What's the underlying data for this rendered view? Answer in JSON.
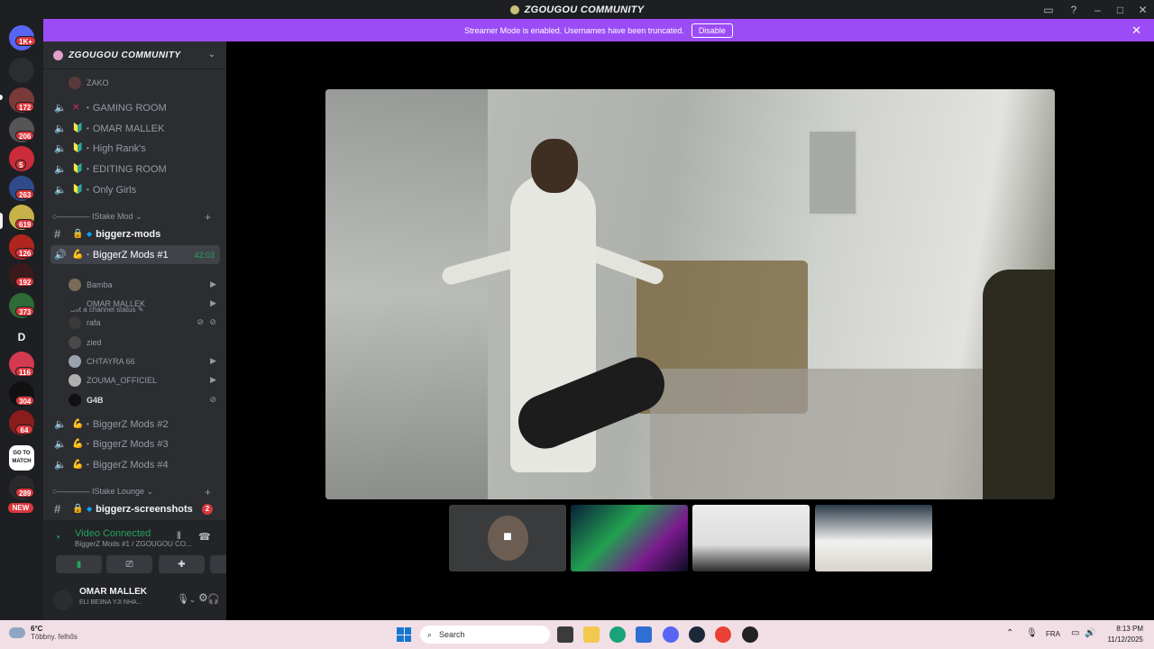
{
  "window": {
    "title": "ZGOUGOU COMMUNITY"
  },
  "banner": {
    "text": "Streamer Mode is enabled. Usernames have been truncated.",
    "button": "Disable"
  },
  "rail": {
    "home_badge": "1K+",
    "badges": [
      "172",
      "206",
      "5",
      "263",
      "619",
      "126",
      "192",
      "373",
      "116",
      "304",
      "64",
      "289"
    ],
    "letter_server": "D",
    "new_label": "NEW",
    "match_label": "GO TO MATCH"
  },
  "server": {
    "name": "ZGOUGOU COMMUNITY"
  },
  "channels": {
    "top_user": "ZAKO",
    "voice_top": [
      {
        "emoji": "✕",
        "label": "GAMING ROOM"
      },
      {
        "emoji": "🔰",
        "label": "OMAR MALLEK"
      },
      {
        "emoji": "🔰",
        "label": "High Rank's"
      },
      {
        "emoji": "🔰",
        "label": "EDITING ROOM"
      },
      {
        "emoji": "🔰",
        "label": "Only Girls"
      }
    ],
    "category_mod": "IStake Mod",
    "text_mods": "biggerz-mods",
    "active_voice": {
      "label": "BiggerZ Mods #1",
      "duration": "42:03",
      "status": "Set a channel status"
    },
    "members": [
      {
        "name": "Bamba"
      },
      {
        "name": "OMAR MALLEK"
      },
      {
        "name": "rafa"
      },
      {
        "name": "zied"
      },
      {
        "name": "CHTAYRA 66"
      },
      {
        "name": "ZOUMA_OFFICIEL"
      },
      {
        "name": "G4B"
      }
    ],
    "voice_more": [
      "BiggerZ Mods #2",
      "BiggerZ Mods #3",
      "BiggerZ Mods #4"
    ],
    "category_lounge": "IStake Lounge",
    "text_screens": "biggerz-screenshots",
    "text_screens_ping": "2"
  },
  "voice_panel": {
    "title": "Video Connected",
    "subtitle": "BiggerZ Mods #1 / ZGOUGOU CO..."
  },
  "me": {
    "name": "OMAR MALLEK",
    "status": "ELI BE3NA YJI NHA..."
  },
  "taskbar": {
    "temp": "6°C",
    "condition": "Többny. felhős",
    "search": "Search",
    "lang": "FRA",
    "time": "8:13 PM",
    "date": "11/12/2025"
  },
  "colors": {
    "accent": "#9b4cf7",
    "online": "#23a55a",
    "badge": "#da373c"
  }
}
